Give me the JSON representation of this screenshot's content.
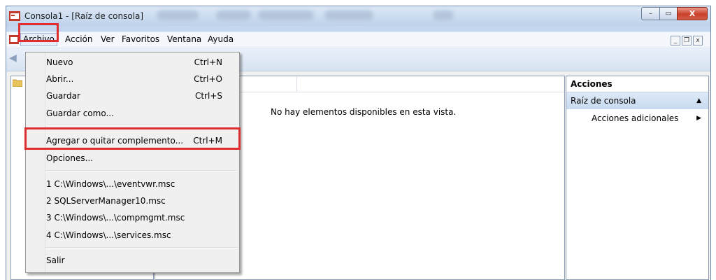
{
  "window": {
    "title": "Consola1 - [Raíz de consola]",
    "minimize_label": "–",
    "maximize_label": "▭",
    "close_label": "X"
  },
  "menubar": {
    "items": [
      "Archivo",
      "Acción",
      "Ver",
      "Favoritos",
      "Ventana",
      "Ayuda"
    ],
    "mdi_min": "_",
    "mdi_restore": "❐",
    "mdi_close": "x"
  },
  "file_menu": {
    "items": [
      {
        "label": "Nuevo",
        "shortcut": "Ctrl+N"
      },
      {
        "label": "Abrir...",
        "shortcut": "Ctrl+O"
      },
      {
        "label": "Guardar",
        "shortcut": "Ctrl+S"
      },
      {
        "label": "Guardar como...",
        "shortcut": ""
      },
      {
        "label": "Agregar o quitar complemento...",
        "shortcut": "Ctrl+M"
      },
      {
        "label": "Opciones...",
        "shortcut": ""
      },
      {
        "label": "1 C:\\Windows\\...\\eventvwr.msc",
        "shortcut": ""
      },
      {
        "label": "2 SQLServerManager10.msc",
        "shortcut": ""
      },
      {
        "label": "3 C:\\Windows\\...\\compmgmt.msc",
        "shortcut": ""
      },
      {
        "label": "4 C:\\Windows\\...\\services.msc",
        "shortcut": ""
      },
      {
        "label": "Salir",
        "shortcut": ""
      }
    ]
  },
  "center": {
    "empty_message": "No hay elementos disponibles en esta vista."
  },
  "actions": {
    "header": "Acciones",
    "group": "Raíz de consola",
    "group_arrow": "▲",
    "sub_item": "Acciones adicionales",
    "sub_arrow": "▶"
  },
  "colors": {
    "highlight": "#e02d2d",
    "titlebar": "#bed2ea",
    "close_button": "#c9402a"
  }
}
